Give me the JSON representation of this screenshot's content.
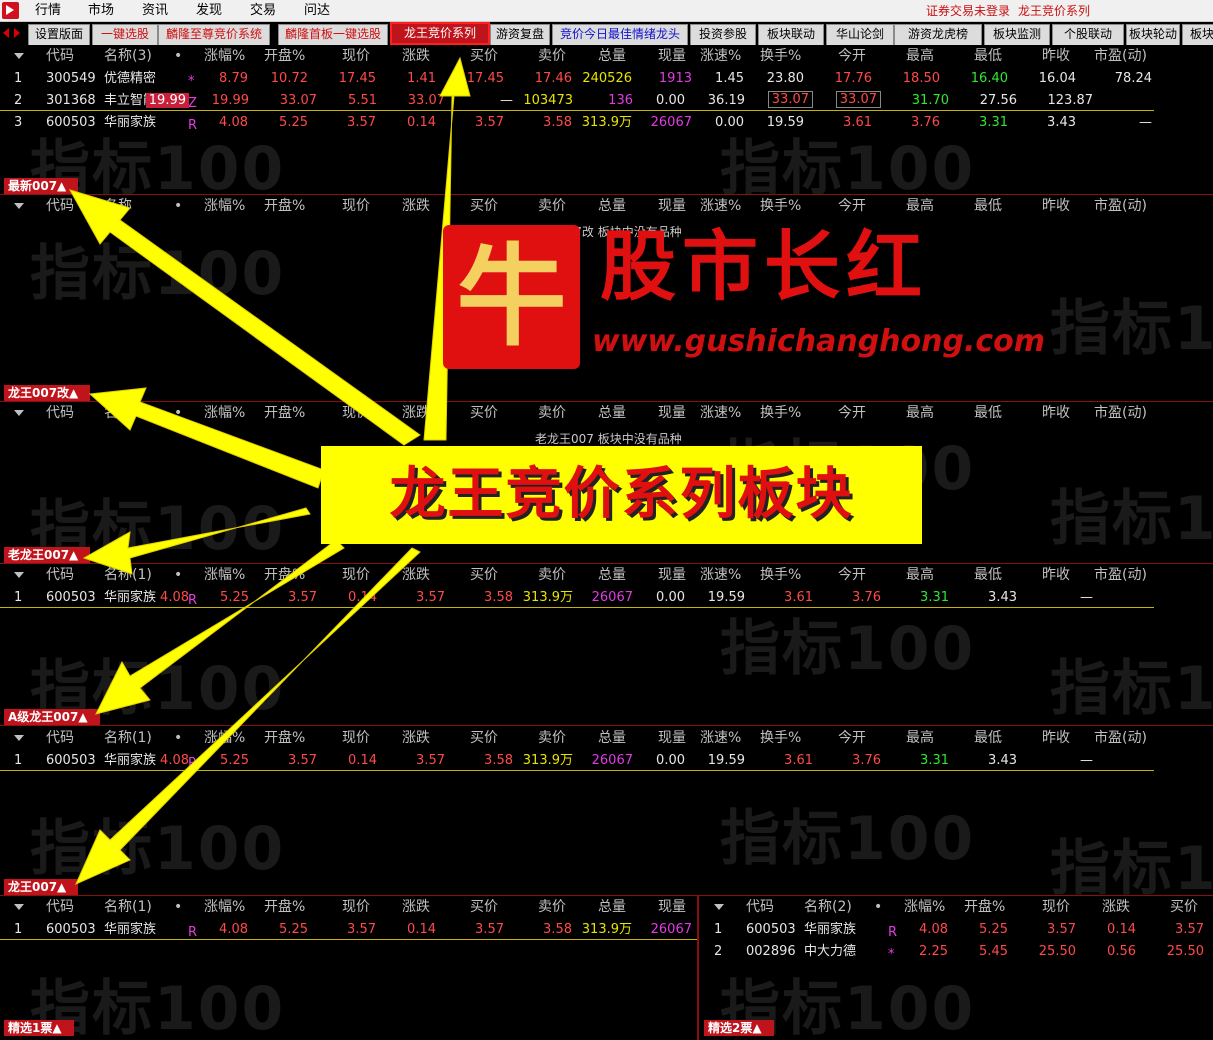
{
  "menu": {
    "items": [
      "行情",
      "市场",
      "资讯",
      "发现",
      "交易",
      "问达"
    ],
    "status": "证券交易未登录",
    "system_name": "龙王竞价系列"
  },
  "tabs": [
    {
      "label": "设置版面",
      "color": "#000000"
    },
    {
      "label": "一键选股",
      "color": "#d01010"
    },
    {
      "label": "麟隆至尊竞价系统",
      "color": "#d01010"
    },
    {
      "label": "麟隆首板一键选股",
      "color": "#d01010"
    },
    {
      "label": "龙王竞价系列",
      "color": "#ffffff",
      "active": true
    },
    {
      "label": "游资复盘",
      "color": "#000000"
    },
    {
      "label": "竞价今日最佳情绪龙头",
      "color": "#1010d0"
    },
    {
      "label": "投资参股",
      "color": "#000000"
    },
    {
      "label": "板块联动",
      "color": "#000000"
    },
    {
      "label": "华山论剑",
      "color": "#000000"
    },
    {
      "label": "游资龙虎榜",
      "color": "#000000"
    },
    {
      "label": "板块监测",
      "color": "#000000"
    },
    {
      "label": "个股联动",
      "color": "#000000"
    },
    {
      "label": "板块轮动",
      "color": "#000000"
    },
    {
      "label": "板块",
      "color": "#000000"
    }
  ],
  "columns": [
    "代码",
    "名称",
    "涨幅%",
    "开盘%",
    "现价",
    "涨跌",
    "买价",
    "卖价",
    "总量",
    "现量",
    "涨速%",
    "换手%",
    "今开",
    "最高",
    "最低",
    "昨收",
    "市盈(动)"
  ],
  "watermark": "指标100",
  "panels": [
    {
      "label": "最新007▲",
      "name_header": "名称(3)",
      "rows": [
        {
          "idx": "1",
          "code": "300549",
          "name": "优德精密",
          "flag": "*",
          "chg": "8.79",
          "open_pct": "10.72",
          "price": "17.45",
          "diff": "1.41",
          "bid": "17.45",
          "ask": "17.46",
          "vol": "240526",
          "cur_vol": "1913",
          "speed": "1.45",
          "turnover": "23.80",
          "today_open": "17.76",
          "high": "18.50",
          "low": "16.40",
          "prev": "16.04",
          "pe": "78.24"
        },
        {
          "idx": "2",
          "code": "301368",
          "name": "丰立智能",
          "flag": "Z",
          "chg": "19.99",
          "open_pct": "19.99",
          "price": "33.07",
          "diff": "5.51",
          "bid": "33.07",
          "ask": "—",
          "vol": "103473",
          "cur_vol": "136",
          "speed": "0.00",
          "turnover": "36.19",
          "today_open": "33.07",
          "high": "33.07",
          "low": "31.70",
          "prev": "27.56",
          "pe": "123.87"
        },
        {
          "idx": "3",
          "code": "600503",
          "name": "华丽家族",
          "flag": "R",
          "chg": "4.08",
          "open_pct": "5.25",
          "price": "3.57",
          "diff": "0.14",
          "bid": "3.57",
          "ask": "3.58",
          "vol": "313.9万",
          "cur_vol": "26067",
          "speed": "0.00",
          "turnover": "19.59",
          "today_open": "3.61",
          "high": "3.76",
          "low": "3.31",
          "prev": "3.43",
          "pe": "—"
        }
      ]
    },
    {
      "label": "龙王007改▲",
      "name_header": "名称",
      "empty": "龙王007改 板块中没有品种",
      "rows": []
    },
    {
      "label": "老龙王007▲",
      "name_header": "名称",
      "empty": "老龙王007 板块中没有品种",
      "rows": []
    },
    {
      "label": "A级龙王007▲",
      "name_header": "名称(1)",
      "rows": [
        {
          "idx": "1",
          "code": "600503",
          "name": "华丽家族",
          "flag": "R",
          "chg": "4.08",
          "open_pct": "5.25",
          "price": "3.57",
          "diff": "0.14",
          "bid": "3.57",
          "ask": "3.58",
          "vol": "313.9万",
          "cur_vol": "26067",
          "speed": "0.00",
          "turnover": "19.59",
          "today_open": "3.61",
          "high": "3.76",
          "low": "3.31",
          "prev": "3.43",
          "pe": "—"
        }
      ]
    },
    {
      "label": "龙王007▲",
      "name_header": "名称(1)",
      "rows": [
        {
          "idx": "1",
          "code": "600503",
          "name": "华丽家族",
          "flag": "R",
          "chg": "4.08",
          "open_pct": "5.25",
          "price": "3.57",
          "diff": "0.14",
          "bid": "3.57",
          "ask": "3.58",
          "vol": "313.9万",
          "cur_vol": "26067",
          "speed": "0.00",
          "turnover": "19.59",
          "today_open": "3.61",
          "high": "3.76",
          "low": "3.31",
          "prev": "3.43",
          "pe": "—"
        }
      ]
    },
    {
      "label": "精选1票▲",
      "name_header": "名称(1)",
      "rows": [
        {
          "idx": "1",
          "code": "600503",
          "name": "华丽家族",
          "flag": "R",
          "chg": "4.08",
          "open_pct": "5.25",
          "price": "3.57",
          "diff": "0.14",
          "bid": "3.57",
          "ask": "3.58",
          "vol": "313.9万",
          "cur_vol": "26067"
        }
      ]
    },
    {
      "label": "精选2票▲",
      "name_header": "名称(2)",
      "rows": [
        {
          "idx": "1",
          "code": "600503",
          "name": "华丽家族",
          "flag": "R",
          "chg": "4.08",
          "open_pct": "5.25",
          "price": "3.57",
          "diff": "0.14",
          "bid": "3.57"
        },
        {
          "idx": "2",
          "code": "002896",
          "name": "中大力德",
          "flag": "*",
          "chg": "2.25",
          "open_pct": "5.45",
          "price": "25.50",
          "diff": "0.56",
          "bid": "25.50"
        }
      ]
    }
  ],
  "overlay": {
    "promo_text": "龙王竞价系列板块",
    "logo_glyph": "牛",
    "logo_title": "股市长红",
    "logo_url": "www.gushichanghong.com"
  },
  "colors": {
    "up": "#ff4a4a",
    "volume": "#e8e400",
    "cur_volume": "#e13ce1",
    "low": "#30e830",
    "active_tab": "#c0141c",
    "arrow": "#ffff00"
  }
}
